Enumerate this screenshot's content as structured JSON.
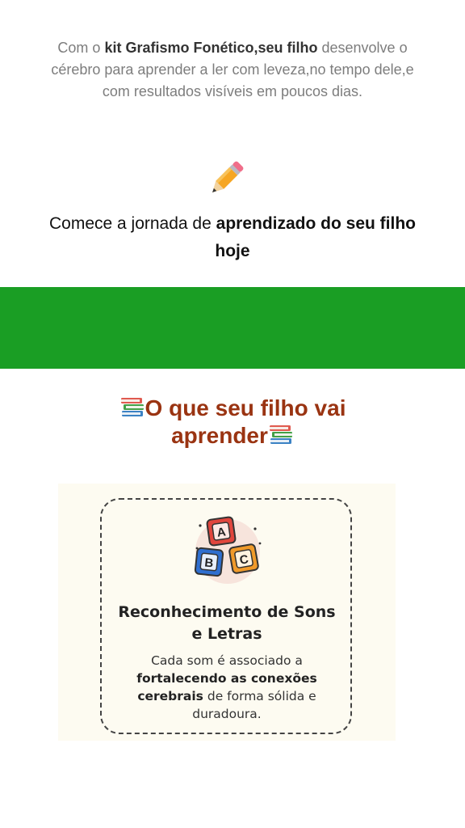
{
  "intro": {
    "part1": "Com o ",
    "bold": "kit Grafismo Fonético,seu filho",
    "part2": " desenvolve o cérebro para aprender a ler com leveza,no tempo dele,e com resultados visíveis em poucos dias."
  },
  "pencil_icon": "pencil-icon",
  "cta": {
    "part1": "Comece a jornada de ",
    "bold": "aprendizado do seu filho hoje"
  },
  "band_color": "#1a9e24",
  "learn_section": {
    "title": "O que seu filho vai aprender",
    "icon": "books-icon",
    "title_color": "#9a3412"
  },
  "card": {
    "icon": "abc-blocks-icon",
    "title": "Reconhecimento de Sons e Letras",
    "text_part1": "Cada som é associado a ",
    "text_bold": "fortalecendo as conexões cerebrais",
    "text_part2": " de forma sólida e duradoura.",
    "block_letters": [
      "A",
      "B",
      "C"
    ]
  }
}
